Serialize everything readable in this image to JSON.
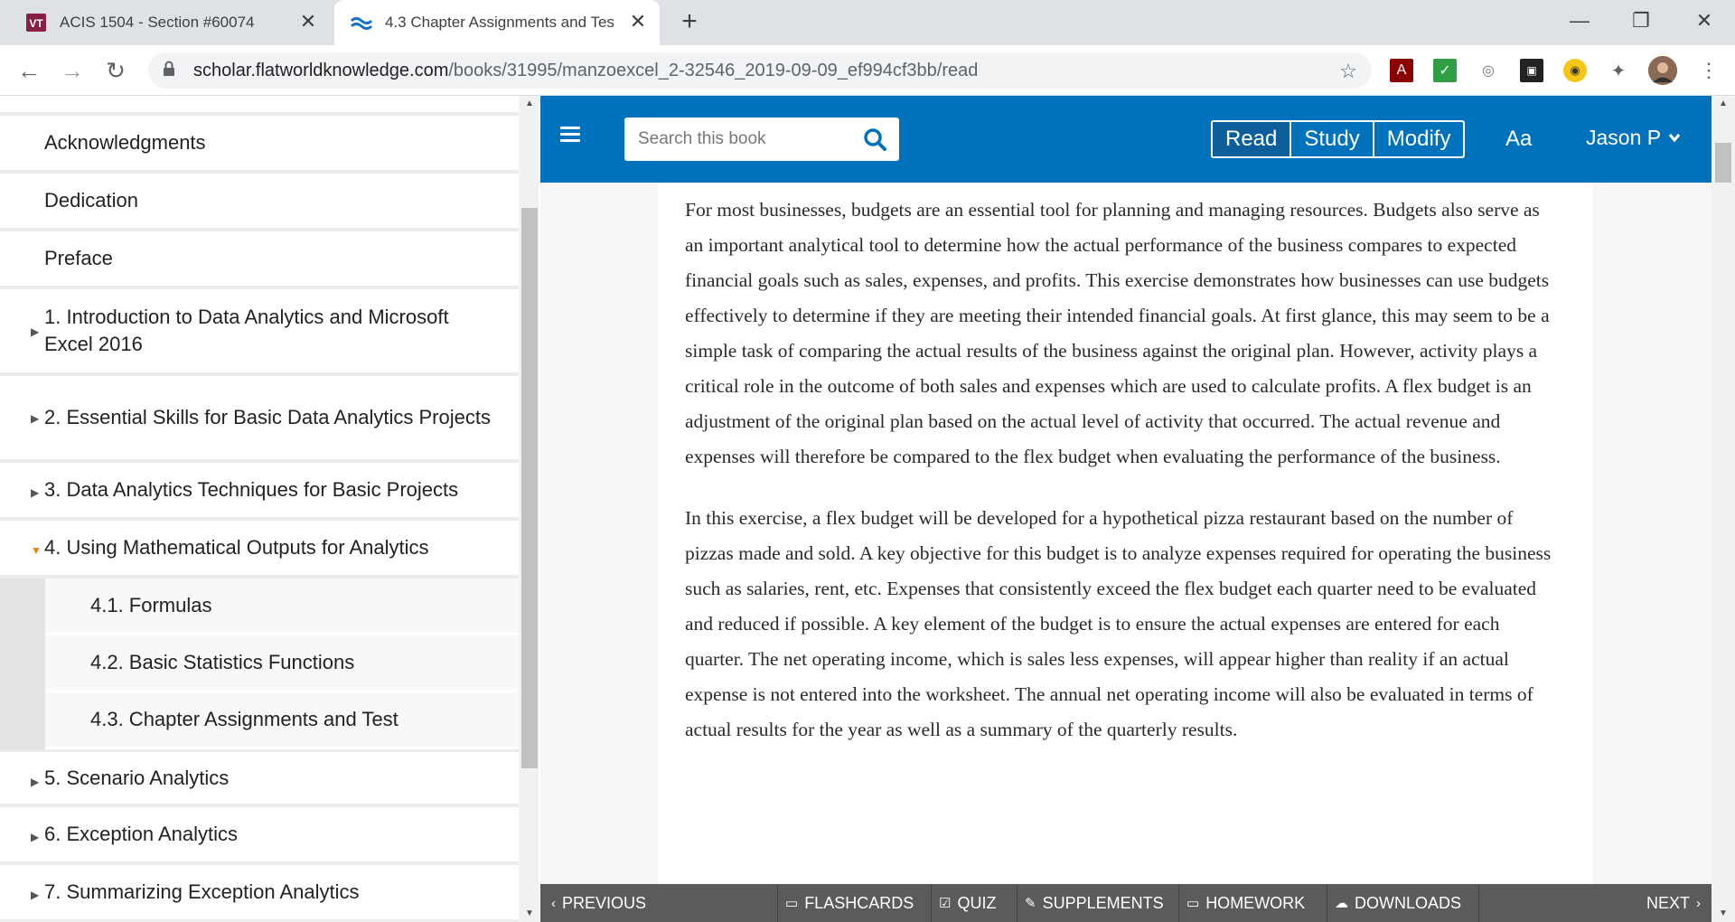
{
  "browser": {
    "tabs": [
      {
        "title": "ACIS 1504 - Section #60074",
        "favicon": "vt-logo-icon",
        "active": false
      },
      {
        "title": "4.3 Chapter Assignments and Tes",
        "favicon": "flatworld-icon",
        "active": true
      }
    ],
    "url_host": "scholar.flatworldknowledge.com",
    "url_path": "/books/31995/manzoexcel_2-32546_2019-09-09_ef994cf3bb/read"
  },
  "sidebar": {
    "items": [
      {
        "label": "Acknowledgments"
      },
      {
        "label": "Dedication"
      },
      {
        "label": "Preface"
      },
      {
        "label": "1. Introduction to Data Analytics and Microsoft Excel 2016"
      },
      {
        "label": "2. Essential Skills for Basic Data Analytics Projects"
      },
      {
        "label": "3. Data Analytics Techniques for Basic Projects"
      },
      {
        "label": "4. Using Mathematical Outputs for Analytics"
      },
      {
        "label": "4.1. Formulas"
      },
      {
        "label": "4.2. Basic Statistics Functions"
      },
      {
        "label": "4.3. Chapter Assignments and Test"
      },
      {
        "label": "5. Scenario Analytics"
      },
      {
        "label": "6. Exception Analytics"
      },
      {
        "label": "7. Summarizing Exception Analytics"
      }
    ]
  },
  "appbar": {
    "search_placeholder": "Search this book",
    "modes": [
      "Read",
      "Study",
      "Modify"
    ],
    "font_toggle": "Aa",
    "user_name": "Jason P"
  },
  "content": {
    "paragraphs": [
      "For most businesses, budgets are an essential tool for planning and managing resources. Budgets also serve as an important analytical tool to determine how the actual performance of the business compares to expected financial goals such as sales, expenses, and profits. This exercise demonstrates how businesses can use budgets effectively to determine if they are meeting their intended financial goals. At first glance, this may seem to be a simple task of comparing the actual results of the business against the original plan. However, activity plays a critical role in the outcome of both sales and expenses which are used to calculate profits. A flex budget is an adjustment of the original plan based on the actual level of activity that occurred. The actual revenue and expenses will therefore be compared to the flex budget when evaluating the performance of the business.",
      "In this exercise, a flex budget will be developed for a hypothetical pizza restaurant based on the number of pizzas made and sold. A key objective for this budget is to analyze expenses required for operating the business such as salaries, rent, etc. Expenses that consistently exceed the flex budget each quarter need to be evaluated and reduced if possible. A key element of the budget is to ensure the actual expenses are entered for each quarter. The net operating income, which is sales less expenses, will appear higher than reality if an actual expense is not entered into the worksheet. The annual net operating income will also be evaluated in terms of actual results for the year as well as a summary of the quarterly results."
    ]
  },
  "bottombar": {
    "previous": "PREVIOUS",
    "flashcards": "FLASHCARDS",
    "quiz": "QUIZ",
    "supplements": "SUPPLEMENTS",
    "homework": "HOMEWORK",
    "downloads": "DOWNLOADS",
    "next": "NEXT"
  }
}
